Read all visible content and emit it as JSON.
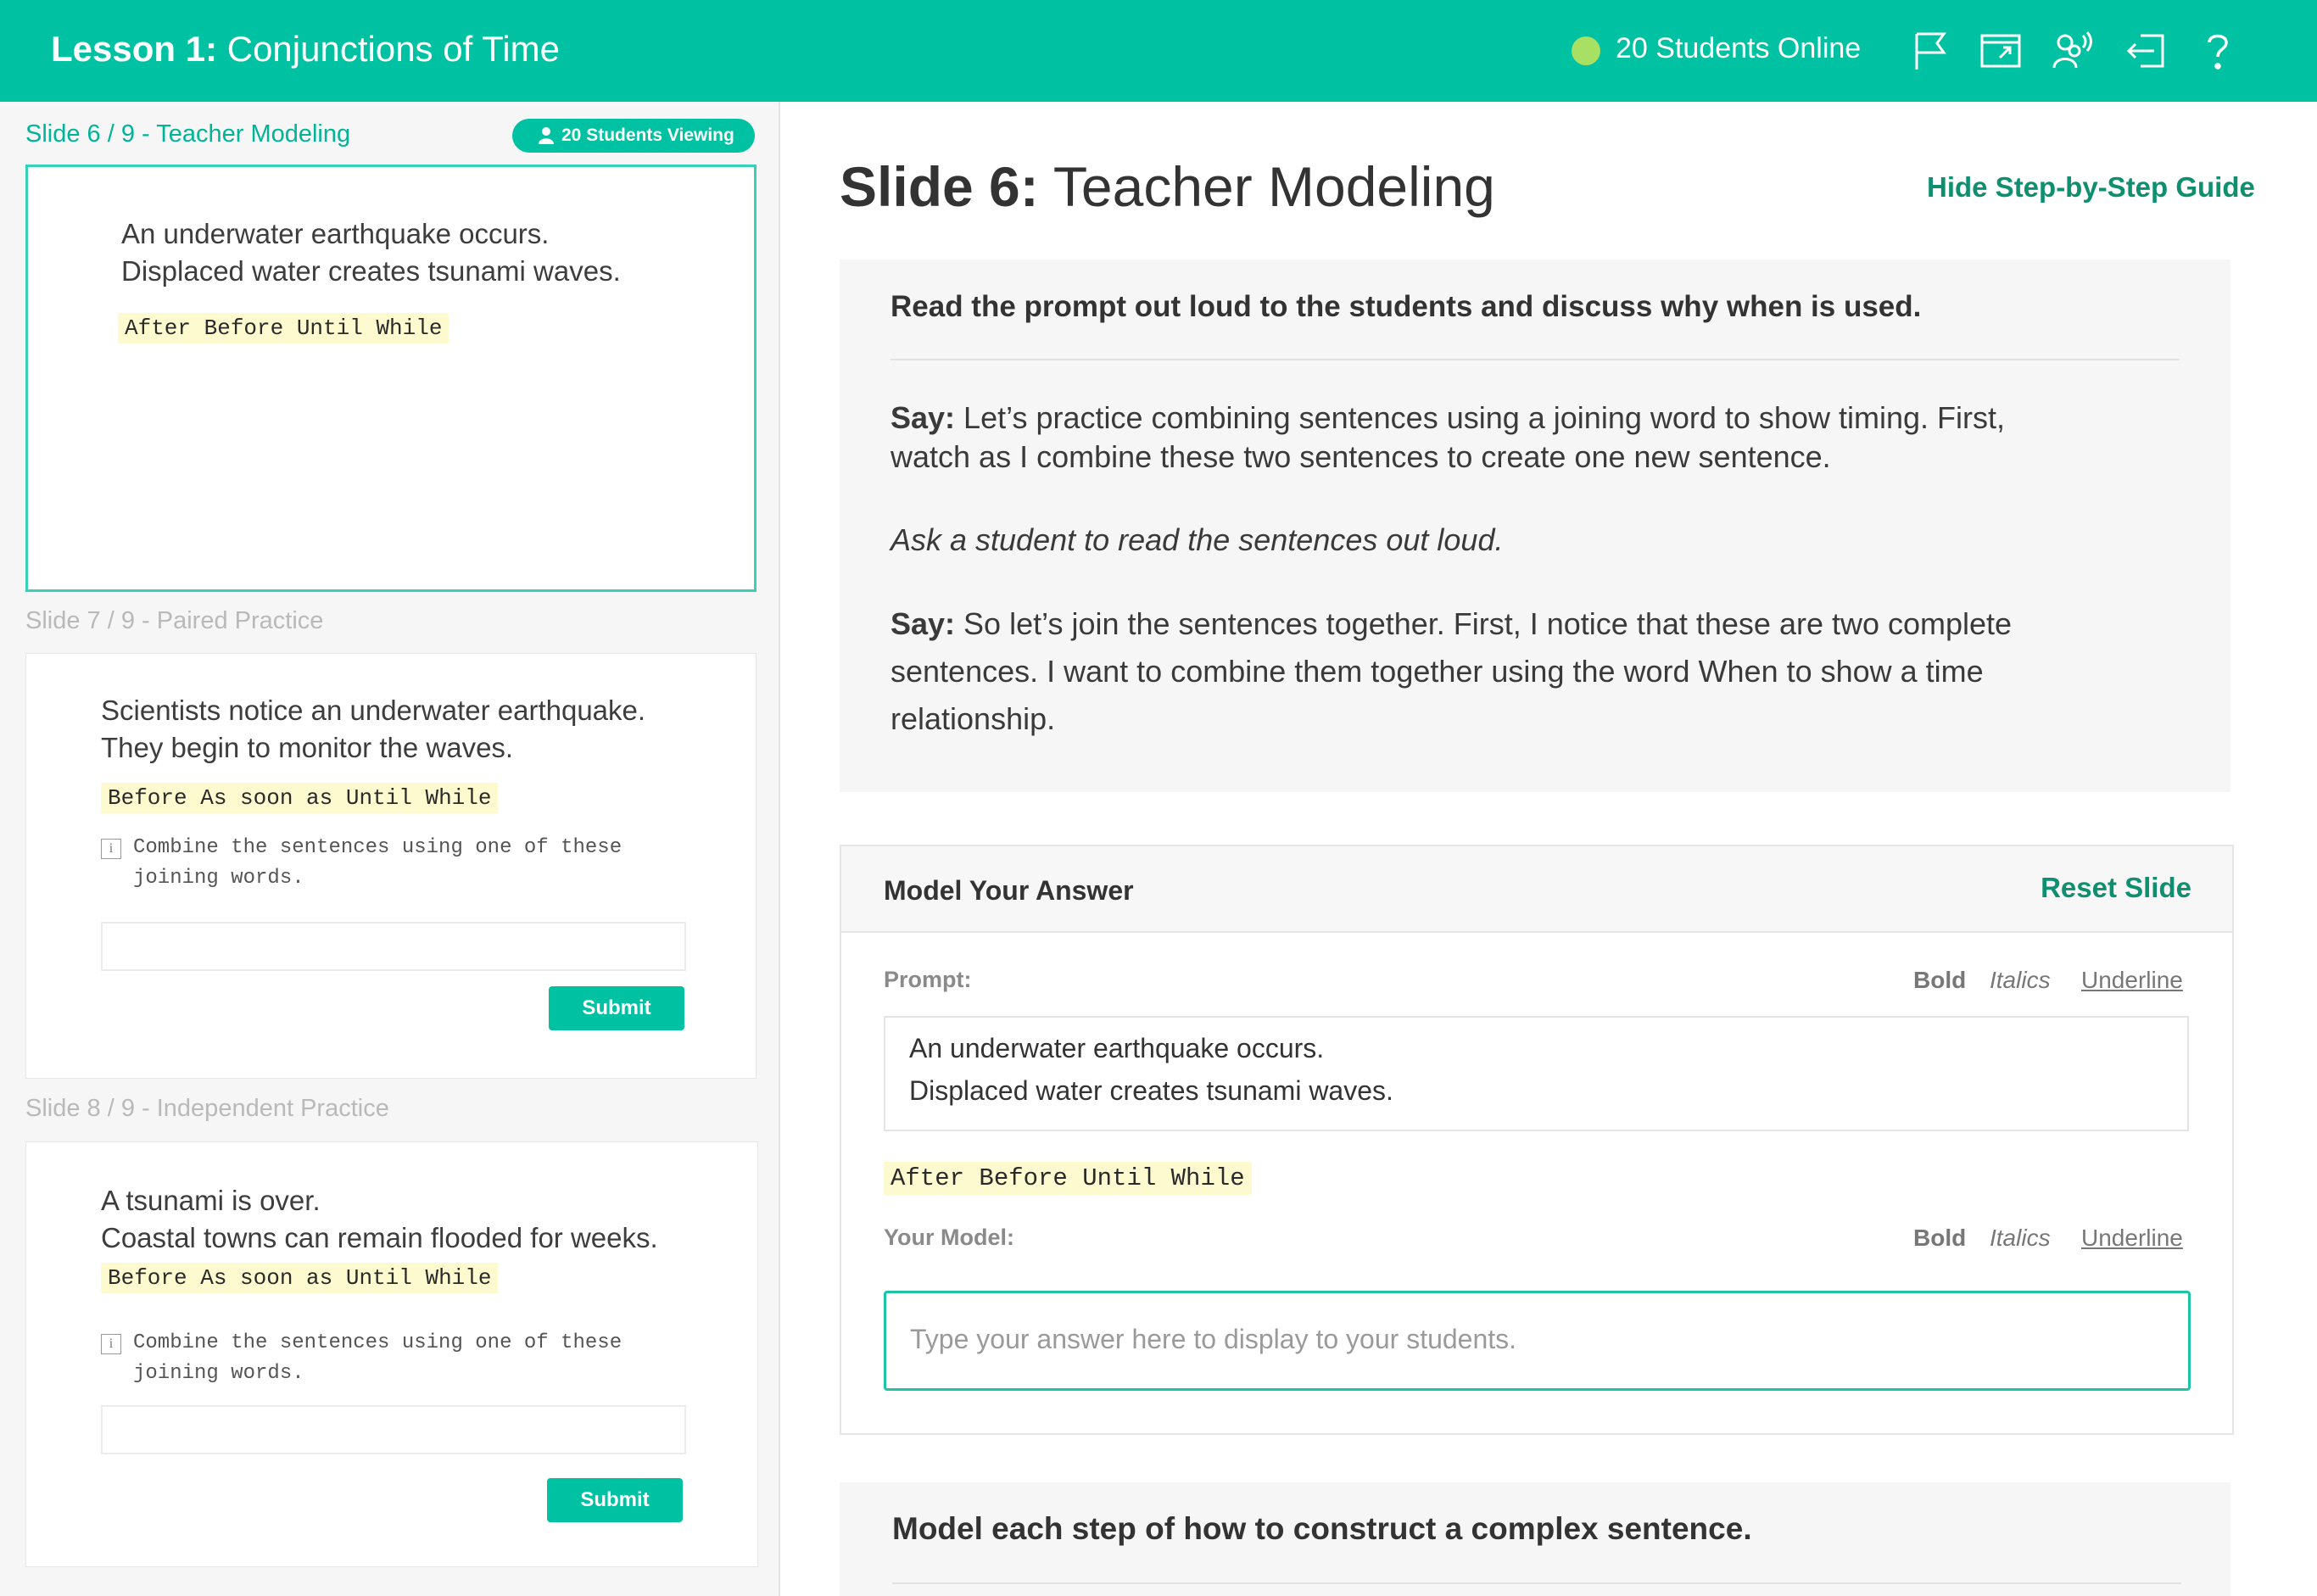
{
  "header": {
    "lesson_label": "Lesson 1:",
    "lesson_name": "Conjunctions of Time",
    "online_text": "20 Students Online",
    "accent": "#00c2a2",
    "icons": [
      "flag-icon",
      "present-icon",
      "students-audio-icon",
      "exit-icon",
      "help-icon"
    ]
  },
  "sidebar": {
    "slides": [
      {
        "label": "Slide 6 / 9 - Teacher Modeling",
        "badge": "20 Students Viewing",
        "lines": [
          "An underwater earthquake occurs.",
          "Displaced water creates tsunami waves."
        ],
        "words": "After Before Until While"
      },
      {
        "label": "Slide 7 / 9 - Paired Practice",
        "lines": [
          "Scientists notice an underwater earthquake.",
          "They begin to monitor the waves."
        ],
        "words": "Before As soon as Until While",
        "hint": "Combine the sentences using one of these\njoining words.",
        "submit": "Submit"
      },
      {
        "label": "Slide 8 / 9 - Independent Practice",
        "lines": [
          "A tsunami is over.",
          "Coastal towns can remain flooded for weeks."
        ],
        "words": "Before As soon as Until While",
        "hint": "Combine the sentences using one of these\njoining words.",
        "submit": "Submit"
      }
    ]
  },
  "main": {
    "slide_num": "Slide 6:",
    "slide_name": "Teacher Modeling",
    "hide_guide": "Hide Step-by-Step Guide",
    "guide": {
      "heading": "Read the prompt out loud to the students and discuss why when is used.",
      "say1_label": "Say:",
      "say1_text": " Let’s practice combining sentences using a joining word to show timing. First, watch as I combine these two sentences to create one new sentence.",
      "instruction": "Ask a student to read the sentences out loud.",
      "say2_label": "Say:",
      "say2_text": " So let’s join the sentences together. First, I notice that these are two complete sentences. I want to combine them together using the word When to show a time relationship."
    },
    "model": {
      "title": "Model Your Answer",
      "reset": "Reset Slide",
      "prompt_label": "Prompt:",
      "your_model_label": "Your Model:",
      "format": {
        "bold": "Bold",
        "italics": "Italics",
        "underline": "Underline"
      },
      "prompt_lines": [
        "An underwater earthquake occurs.",
        "Displaced water creates tsunami waves."
      ],
      "words": "After Before Until While",
      "placeholder": "Type your answer here to display to your students."
    },
    "steps_heading": "Model each step of how to construct a complex sentence."
  }
}
